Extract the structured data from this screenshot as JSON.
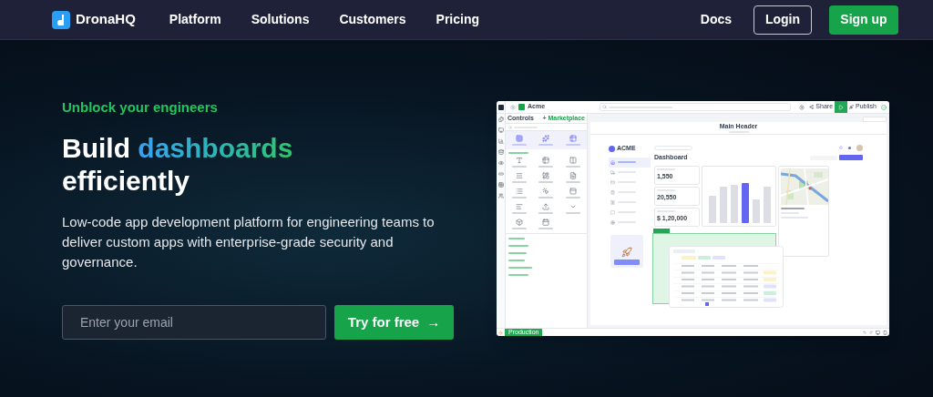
{
  "nav": {
    "brand": "DronaHQ",
    "links": [
      "Platform",
      "Solutions",
      "Customers",
      "Pricing"
    ],
    "docs": "Docs",
    "login": "Login",
    "signup": "Sign up"
  },
  "hero": {
    "eyebrow": "Unblock your engineers",
    "headline_start": "Build",
    "headline_highlight": "dashboards",
    "headline_end": "efficiently",
    "description": "Low-code app development platform for engineering teams to deliver custom apps with enterprise-grade security and governance.",
    "email_placeholder": "Enter your email",
    "cta": "Try for free",
    "cta_arrow": "→"
  },
  "app_preview": {
    "app_name": "Acme",
    "share": "Share",
    "publish": "Publish",
    "panel_title": "Controls",
    "marketplace": "+ Marketplace",
    "main_header": "Main Header",
    "brand": "ACME",
    "page_title": "Dashboard",
    "menu": [
      {
        "selected": true
      },
      {
        "selected": false
      },
      {
        "selected": false
      },
      {
        "selected": false
      },
      {
        "selected": false
      },
      {
        "selected": false
      },
      {
        "selected": false
      }
    ],
    "stats": [
      {
        "value": "1,550"
      },
      {
        "value": "20,550"
      },
      {
        "value": "$ 1,20,000"
      }
    ],
    "environment": "Production"
  }
}
